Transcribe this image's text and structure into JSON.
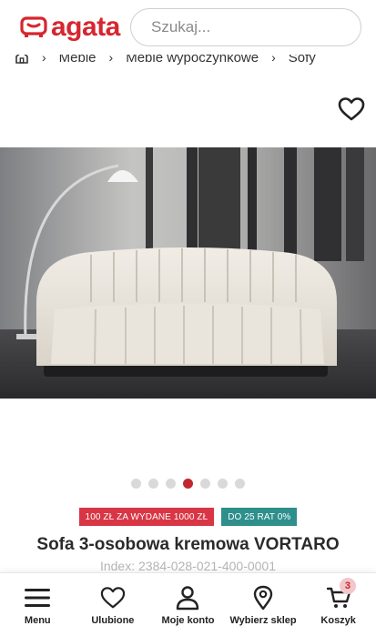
{
  "header": {
    "logo_text": "agata",
    "search_placeholder": "Szukaj..."
  },
  "breadcrumb": {
    "items": [
      "Meble",
      "Meble wypoczynkowe",
      "Sofy"
    ]
  },
  "gallery": {
    "total_images": 7,
    "active_index": 3
  },
  "badges": {
    "promo": "100 ZŁ ZA WYDANE 1000 ZŁ",
    "installments": "DO 25 RAT 0%"
  },
  "product": {
    "title": "Sofa 3-osobowa kremowa VORTARO",
    "index": "Index: 2384-028-021-400-0001"
  },
  "bottom_nav": {
    "items": [
      {
        "label": "Menu",
        "icon": "menu-icon"
      },
      {
        "label": "Ulubione",
        "icon": "heart-icon"
      },
      {
        "label": "Moje konto",
        "icon": "user-icon"
      },
      {
        "label": "Wybierz sklep",
        "icon": "map-pin-icon"
      },
      {
        "label": "Koszyk",
        "icon": "cart-icon"
      }
    ],
    "cart_count": "3"
  },
  "colors": {
    "brand": "#d6262f",
    "active_dot": "#c1272d",
    "badge_promo": "#d83645",
    "badge_installments": "#2e8f8b"
  }
}
